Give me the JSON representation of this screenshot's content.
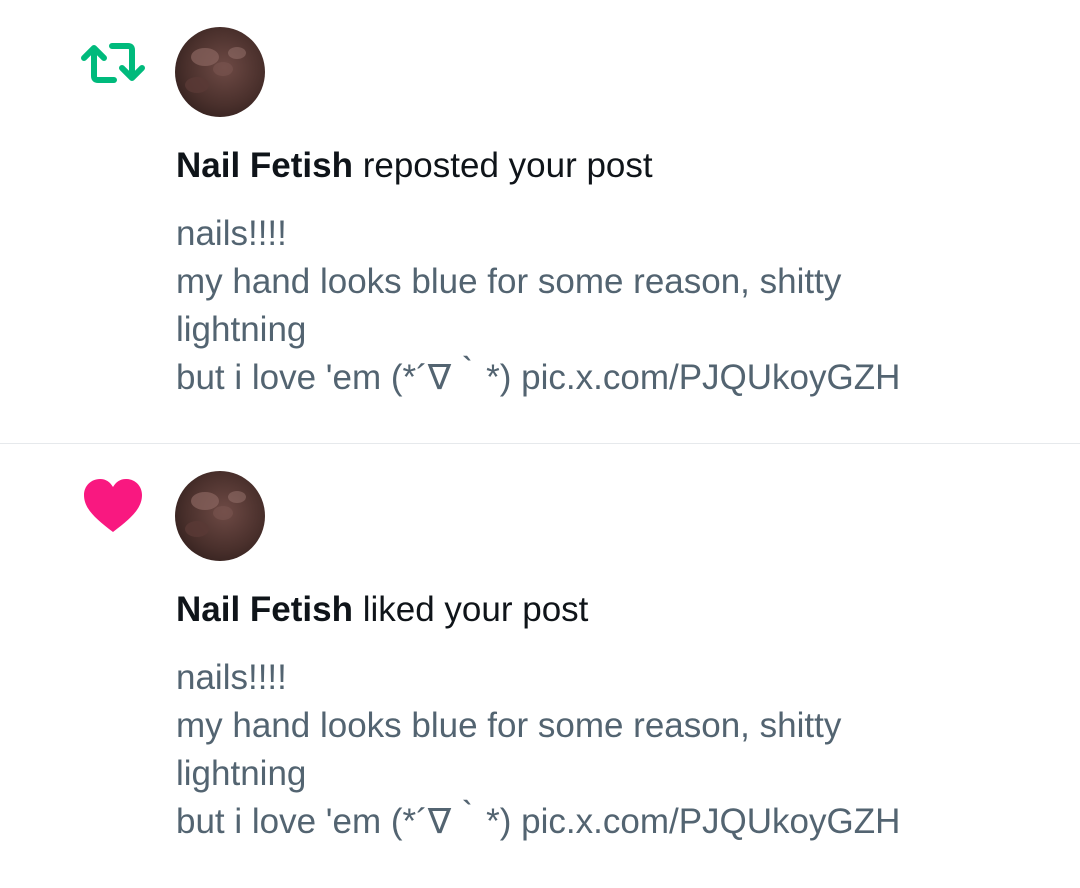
{
  "colors": {
    "repost_icon": "#00ba7c",
    "like_icon": "#f91880",
    "headline_text": "#0f1419",
    "post_text": "#536471",
    "divider": "#e6e9ec"
  },
  "notifications": [
    {
      "type": "repost",
      "icon": "repost-icon",
      "actor": "Nail Fetish",
      "action": " reposted your post",
      "post_lines": [
        "nails!!!!",
        "my hand looks blue for some reason, shitty",
        "lightning",
        "but i love 'em (*´∇｀*) pic.x.com/PJQUkoyGZH"
      ]
    },
    {
      "type": "like",
      "icon": "heart-icon",
      "actor": "Nail Fetish",
      "action": " liked your post",
      "post_lines": [
        "nails!!!!",
        "my hand looks blue for some reason, shitty",
        "lightning",
        "but i love 'em (*´∇｀*) pic.x.com/PJQUkoyGZH"
      ]
    }
  ]
}
